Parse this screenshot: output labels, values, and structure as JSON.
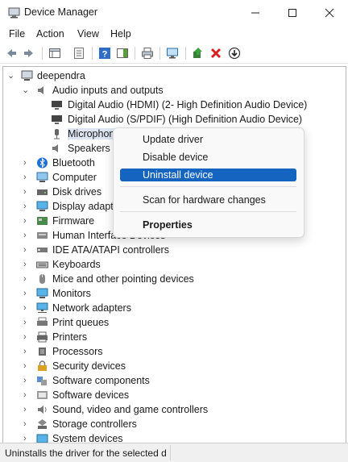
{
  "window": {
    "title": "Device Manager",
    "minimize_icon": "minimize-icon",
    "maximize_icon": "maximize-icon",
    "close_icon": "close-icon"
  },
  "menubar": {
    "items": [
      "File",
      "Action",
      "View",
      "Help"
    ]
  },
  "toolbar": {
    "icons": [
      "back-arrow-icon",
      "forward-arrow-icon",
      "show-hide-console-tree-icon",
      "properties-icon",
      "help-icon",
      "action-pane-icon",
      "print-icon",
      "scan-hardware-icon",
      "update-driver-icon",
      "uninstall-device-icon",
      "disable-device-icon"
    ]
  },
  "tree": {
    "root": "deependra",
    "nodes": [
      {
        "label": "Audio inputs and outputs",
        "expanded": true,
        "icon": "speaker-icon"
      },
      {
        "label": "Digital Audio (HDMI) (2- High Definition Audio Device)",
        "child": true,
        "icon": "monitor-audio-icon"
      },
      {
        "label": "Digital Audio (S/PDIF) (High Definition Audio Device)",
        "child": true,
        "icon": "monitor-audio-icon"
      },
      {
        "label": "Microphone (",
        "child": true,
        "selected": true,
        "icon": "microphone-icon"
      },
      {
        "label": "Speakers (R",
        "child": true,
        "icon": "speaker-icon"
      },
      {
        "label": "Bluetooth",
        "icon": "bluetooth-icon"
      },
      {
        "label": "Computer",
        "icon": "computer-icon"
      },
      {
        "label": "Disk drives",
        "icon": "disk-drive-icon"
      },
      {
        "label": "Display adapters",
        "icon": "display-adapter-icon"
      },
      {
        "label": "Firmware",
        "icon": "firmware-icon"
      },
      {
        "label": "Human Interface Devices",
        "icon": "hid-icon"
      },
      {
        "label": "IDE ATA/ATAPI controllers",
        "icon": "ide-controller-icon"
      },
      {
        "label": "Keyboards",
        "icon": "keyboard-icon"
      },
      {
        "label": "Mice and other pointing devices",
        "icon": "mouse-icon"
      },
      {
        "label": "Monitors",
        "icon": "monitor-icon"
      },
      {
        "label": "Network adapters",
        "icon": "network-adapter-icon"
      },
      {
        "label": "Print queues",
        "icon": "print-queue-icon"
      },
      {
        "label": "Printers",
        "icon": "printer-icon"
      },
      {
        "label": "Processors",
        "icon": "processor-icon"
      },
      {
        "label": "Security devices",
        "icon": "security-device-icon"
      },
      {
        "label": "Software components",
        "icon": "software-component-icon"
      },
      {
        "label": "Software devices",
        "icon": "software-device-icon"
      },
      {
        "label": "Sound, video and game controllers",
        "icon": "sound-controller-icon"
      },
      {
        "label": "Storage controllers",
        "icon": "storage-controller-icon"
      },
      {
        "label": "System devices",
        "icon": "system-device-icon"
      }
    ]
  },
  "context_menu": {
    "items": [
      {
        "label": "Update driver"
      },
      {
        "label": "Disable device"
      },
      {
        "label": "Uninstall device",
        "highlighted": true
      },
      {
        "label": "Scan for hardware changes"
      },
      {
        "label": "Properties",
        "bold": true
      }
    ]
  },
  "statusbar": {
    "text": "Uninstalls the driver for the selected dev"
  },
  "colors": {
    "accent": "#1565c0",
    "selection": "#dde6f2"
  }
}
